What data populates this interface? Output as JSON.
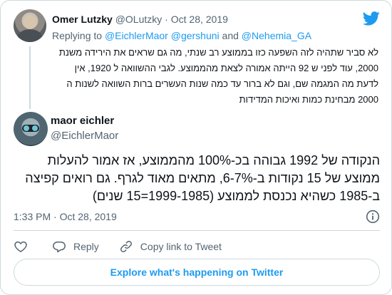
{
  "parent_tweet": {
    "author_name": "Omer Lutzky",
    "author_handle": "@OLutzky",
    "separator": "·",
    "date": "Oct 28, 2019",
    "replying_prefix": "Replying to",
    "mentions": [
      "@EichlerMaor",
      "@gershuni",
      "@Nehemia_GA"
    ],
    "mention_joiner": "and",
    "text": "לא סביר שתהיה לזה השפעה כזו בממוצע רב שנתי, מה גם שראים את הירידה משנת 2000, עוד לפני ש 92 הייתה אמורה לצאת מהממוצע. לגבי ההשוואה ל 1920, אין לדעת מה המגמה שם, וגם לא ברור עד כמה שנות העשרים ברות השוואה לשנות ה 2000 מבחינת כמות ואיכות המדידות"
  },
  "main_tweet": {
    "author_name": "maor eichler",
    "author_handle": "@EichlerMaor",
    "text": "הנקודה של 1992 גבוהה בכ-100% מהממוצע, אז אמור להעלות ממוצע של 15 נקודות ב-6-7%, מתאים מאוד לגרף. גם רואים קפיצה ב-1985 כשהיא נכנסת לממוצע (1999-1985=15 שנים)",
    "time": "1:33 PM",
    "separator": "·",
    "date": "Oct 28, 2019"
  },
  "actions": {
    "reply_label": "Reply",
    "copy_link_label": "Copy link to Tweet"
  },
  "explore_label": "Explore what's happening on Twitter",
  "icons": {
    "brand": "twitter-bird-icon",
    "info": "info-icon",
    "like": "heart-icon",
    "reply": "speech-bubble-icon",
    "copy": "link-icon"
  },
  "colors": {
    "accent": "#1d9bf0",
    "secondary_text": "#536471",
    "border": "#cfd9de"
  }
}
